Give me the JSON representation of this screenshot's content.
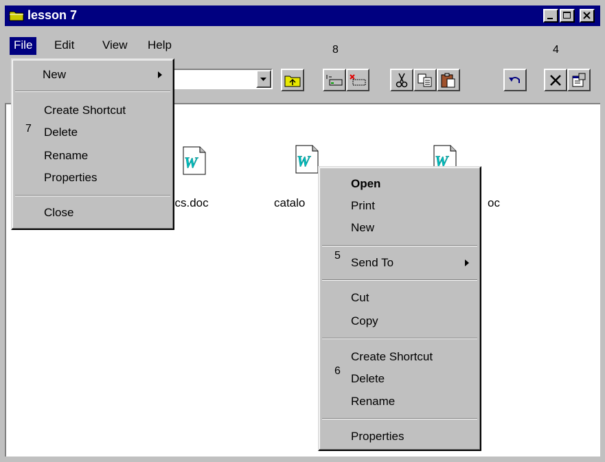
{
  "window": {
    "title": "lesson 7",
    "controls": {
      "minimize": "_",
      "maximize": "□",
      "close": "×"
    }
  },
  "menubar": {
    "file": "File",
    "edit": "Edit",
    "view": "View",
    "help": "Help"
  },
  "annotations": {
    "a8": "8",
    "a4": "4",
    "a7": "7",
    "a5": "5",
    "a6": "6"
  },
  "file_menu": {
    "new": "New",
    "create_shortcut": "Create Shortcut",
    "delete": "Delete",
    "rename": "Rename",
    "properties": "Properties",
    "close": "Close"
  },
  "files": [
    {
      "label": "tics.doc"
    },
    {
      "label": "catalo"
    },
    {
      "label": "oc"
    }
  ],
  "context_menu": {
    "open": "Open",
    "print": "Print",
    "new": "New",
    "send_to": "Send To",
    "cut": "Cut",
    "copy": "Copy",
    "create_shortcut": "Create Shortcut",
    "delete": "Delete",
    "rename": "Rename",
    "properties": "Properties"
  },
  "icons": {
    "title": "folder-icon",
    "up": "up-folder-icon",
    "map_drive": "map-network-drive-icon",
    "disconnect": "disconnect-drive-icon",
    "cut": "scissors-icon",
    "copy": "copy-icon",
    "paste": "paste-icon",
    "undo": "undo-icon",
    "delete": "delete-x-icon",
    "properties": "properties-icon",
    "document": "word-document-icon"
  },
  "colors": {
    "titlebar": "#000080",
    "face": "#c0c0c0",
    "highlight": "#000080"
  }
}
